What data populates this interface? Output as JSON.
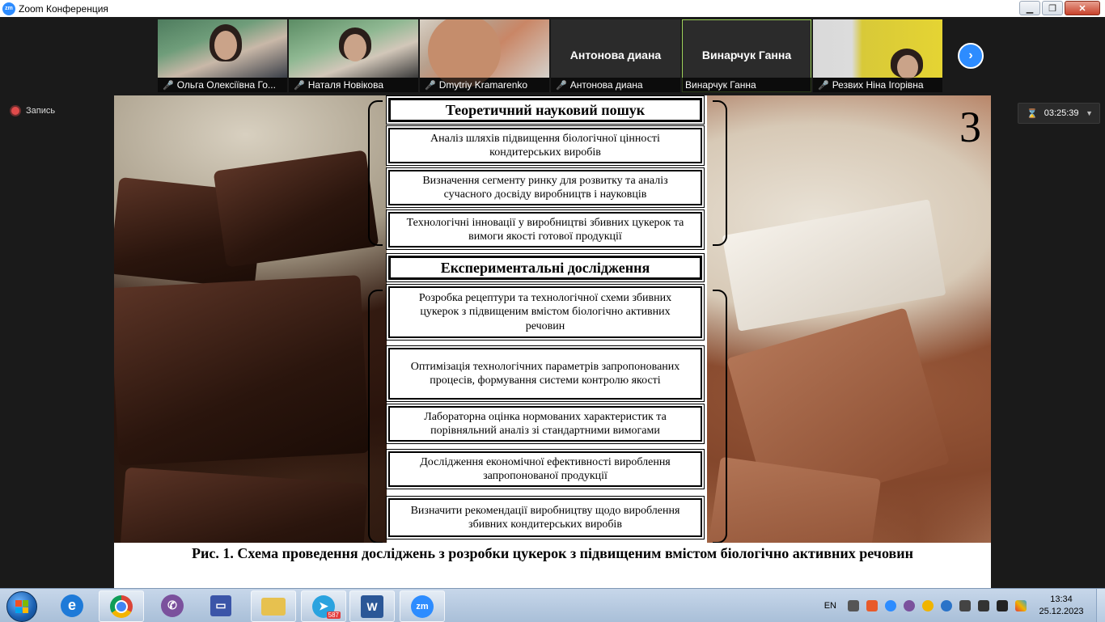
{
  "window": {
    "title": "Zoom Конференция",
    "app_icon_label": "zm"
  },
  "participants": [
    {
      "name": "Ольга Олексіївна Го...",
      "muted": true,
      "video": true
    },
    {
      "name": "Наталя Новікова",
      "muted": true,
      "video": true
    },
    {
      "name": "Dmytriy Kramarenko",
      "muted": true,
      "video": true
    },
    {
      "name": "Антонова диана",
      "big_name": "Антонова диана",
      "muted": true,
      "video": false
    },
    {
      "name": "Винарчук Ганна",
      "big_name": "Винарчук Ганна",
      "muted": false,
      "video": false,
      "active_speaker": true
    },
    {
      "name": "Резвих Ніна Ігорівна",
      "muted": true,
      "video": true
    }
  ],
  "record": {
    "label": "Запись"
  },
  "timer": {
    "value": "03:25:39"
  },
  "slide": {
    "number": "3",
    "section1_title": "Теоретичний науковий пошук",
    "section1_items": [
      "Аналіз шляхів підвищення біологічної цінності кондитерських виробів",
      "Визначення сегменту ринку для розвитку та аналіз сучасного досвіду виробництв і науковців",
      "Технологічні інновації у виробництві збивних цукерок та вимоги якості готової продукції"
    ],
    "section2_title": "Експериментальні дослідження",
    "section2_items": [
      "Розробка рецептури та технологічної схеми збивних цукерок з підвищеним вмістом біологічно активних речовин",
      "Оптимізація технологічних параметрів запропонованих процесів, формування системи контролю якості",
      "Лабораторна оцінка нормованих характеристик та порівняльний аналіз зі стандартними вимогами",
      "Дослідження економічної ефективності вироблення запропонованої продукції",
      "Визначити рекомендації виробництву щодо вироблення збивних кондитерських виробів"
    ],
    "caption": "Рис. 1. Схема проведення досліджень з розробки цукерок з підвищеним вмістом біологічно активних речовин"
  },
  "taskbar": {
    "icons": [
      "start-orb",
      "internet-explorer",
      "chrome",
      "viber",
      "save-disk",
      "file-explorer",
      "telegram",
      "word",
      "zoom"
    ],
    "telegram_badge": "587",
    "word_label": "W",
    "zoom_label": "zm",
    "language": "EN",
    "time": "13:34",
    "date": "25.12.2023"
  },
  "colors": {
    "zoom_blue": "#2d8cff",
    "active_border": "#9fd35a",
    "mute_red": "#e02a2a"
  }
}
